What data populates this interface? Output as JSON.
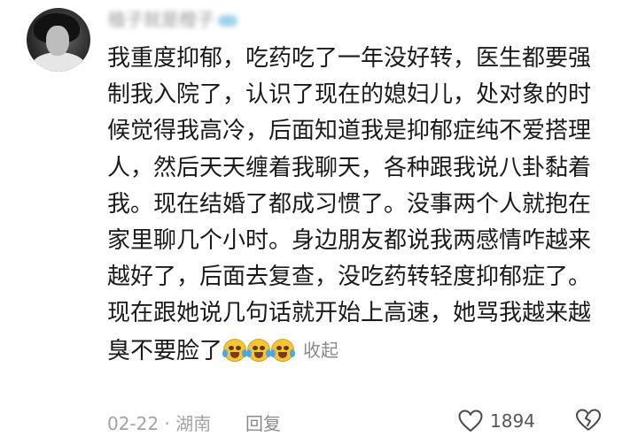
{
  "comment": {
    "username": "植子就是橙子",
    "lines": [
      "我重度抑郁，吃药吃了一年没好转，医生都要强",
      "制我入院了，认识了现在的媳妇儿，处对象的时",
      "候觉得我高冷，后面知道我是抑郁症纯不爱搭理",
      "人，然后天天缠着我聊天，各种跟我说八卦黏着",
      "我。现在结婚了都成习惯了。没事两个人就抱在",
      "家里聊几个小时。身边朋友都说我两感情咋越来",
      "越好了，后面去复查，没吃药转轻度抑郁症了。",
      "现在跟她说几句话就开始上高速，她骂我越来越",
      "臭不要脸了"
    ],
    "emoji_names": [
      "crying-laughing-emoji",
      "crying-laughing-emoji",
      "crying-laughing-emoji"
    ],
    "collapse_label": "收起",
    "date": "02-22",
    "separator": "·",
    "location": "湖南",
    "reply_label": "回复",
    "like_count": "1894",
    "icons": {
      "like": "heart-outline-icon",
      "dislike": "broken-heart-icon"
    }
  }
}
